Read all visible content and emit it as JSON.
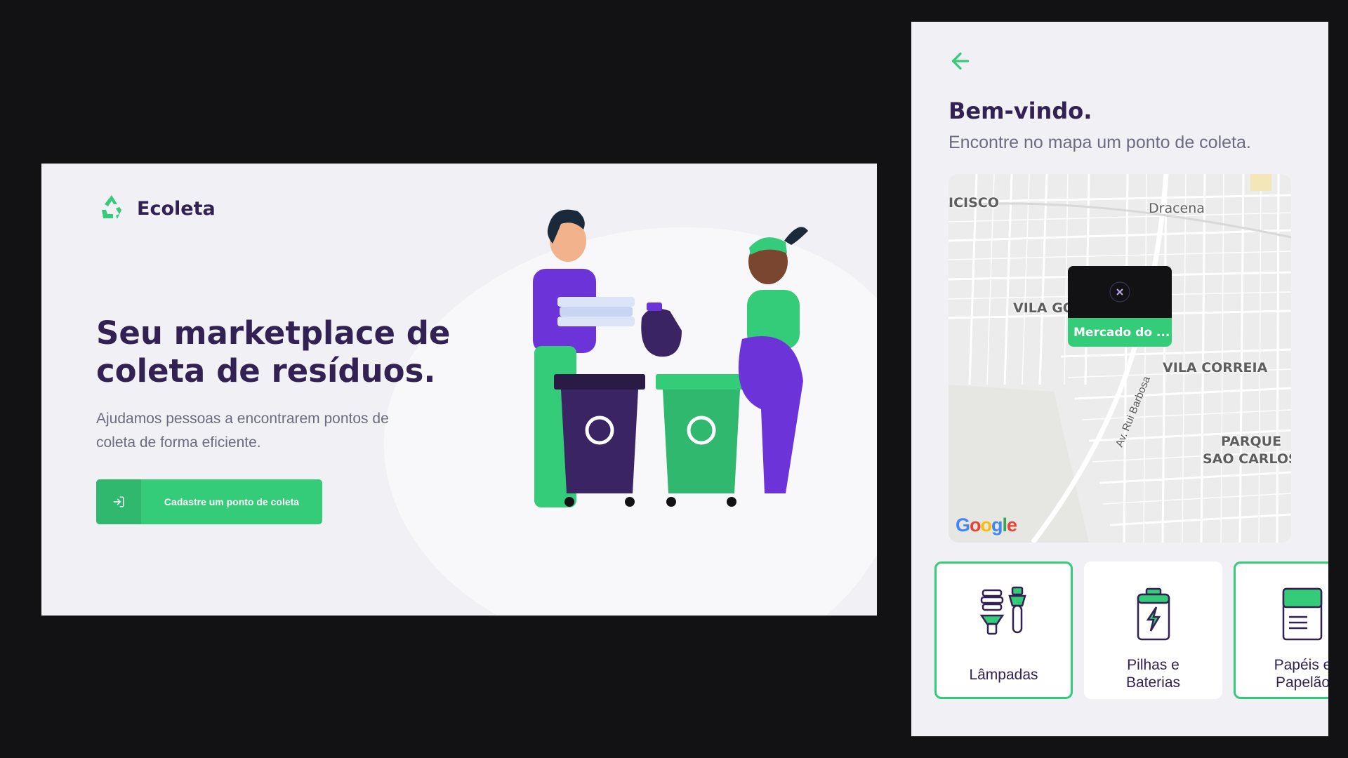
{
  "web": {
    "brand": "Ecoleta",
    "title": "Seu marketplace de coleta de resíduos.",
    "subtitle": "Ajudamos pessoas a encontrarem pontos de coleta de forma eficiente.",
    "cta_label": "Cadastre um ponto de coleta",
    "cta_icon": "log-in-icon"
  },
  "mobile": {
    "title": "Bem-vindo.",
    "subtitle": "Encontre no mapa um ponto de coleta.",
    "map": {
      "labels": [
        "ICISCO",
        "Dracena",
        "VILA GO",
        "VILA CORREIA",
        "PARQUE",
        "SAO CARLOS"
      ],
      "road": "Av. Rui Barbosa",
      "provider": "Google",
      "marker_label": "Mercado do ..."
    },
    "items": [
      {
        "label": "Lâmpadas",
        "icon": "lamps-icon",
        "selected": true
      },
      {
        "label": "Pilhas e\nBaterias",
        "icon": "battery-icon",
        "selected": false
      },
      {
        "label": "Papéis e\nPapelão",
        "icon": "paper-icon",
        "selected": true
      }
    ]
  },
  "colors": {
    "primary": "#34CB79",
    "title": "#322153",
    "text": "#6C6C80",
    "background": "#F0F0F5",
    "canvas": "#121214"
  }
}
